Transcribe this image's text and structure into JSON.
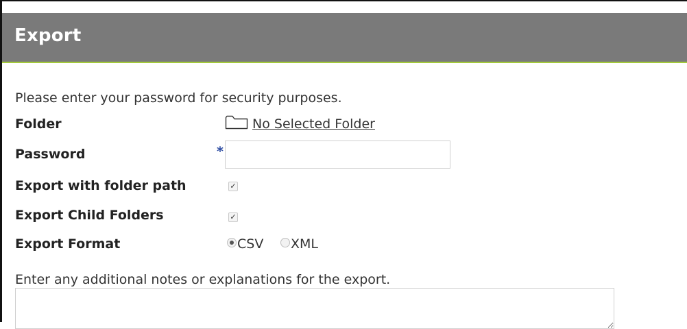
{
  "header": {
    "title": "Export"
  },
  "intro_text": "Please enter your password for security purposes.",
  "form": {
    "folder": {
      "label": "Folder",
      "value": "No Selected Folder",
      "icon": "folder-icon"
    },
    "password": {
      "label": "Password",
      "required_marker": "*",
      "value": ""
    },
    "export_with_folder_path": {
      "label": "Export with folder path",
      "checked": true,
      "check_glyph": "✓"
    },
    "export_child_folders": {
      "label": "Export Child Folders",
      "checked": true,
      "check_glyph": "✓"
    },
    "export_format": {
      "label": "Export Format",
      "options": [
        {
          "label": "CSV",
          "selected": true
        },
        {
          "label": "XML",
          "selected": false
        }
      ]
    },
    "notes": {
      "label": "Enter any additional notes or explanations for the export.",
      "value": ""
    }
  },
  "colors": {
    "header_bg": "#7a7a7a",
    "header_accent": "#a3c93a",
    "required": "#2f4ea3"
  }
}
